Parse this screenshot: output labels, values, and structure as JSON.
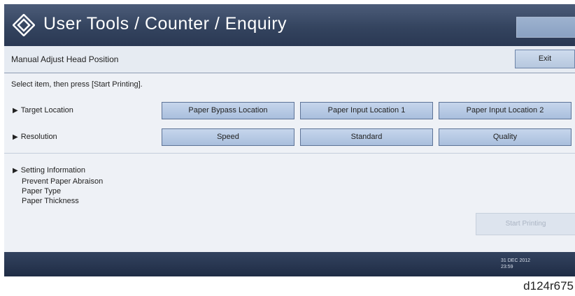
{
  "header": {
    "title": "User Tools / Counter / Enquiry",
    "logo_icon": "diamond-logo-icon",
    "right_button_label": "",
    "colors": {
      "bar": "#34445f",
      "text": "#ffffff"
    }
  },
  "function": {
    "name": "Manual Adjust Head Position",
    "exit_label": "Exit"
  },
  "instruction": "Select item, then press [Start Printing].",
  "target_location": {
    "label": "Target Location",
    "options": [
      "Paper Bypass Location",
      "Paper Input Location 1",
      "Paper Input Location 2"
    ]
  },
  "resolution": {
    "label": "Resolution",
    "options": [
      "Speed",
      "Standard",
      "Quality"
    ]
  },
  "setting_info": {
    "title": "Setting Information",
    "items": [
      "Prevent Paper Abraison",
      "Paper Type",
      "Paper Thickness"
    ]
  },
  "start_button": {
    "label": "Start Printing",
    "enabled": false
  },
  "footer": {
    "date": "31 DEC 2012",
    "time": "23:59"
  },
  "caption": "d124r675"
}
